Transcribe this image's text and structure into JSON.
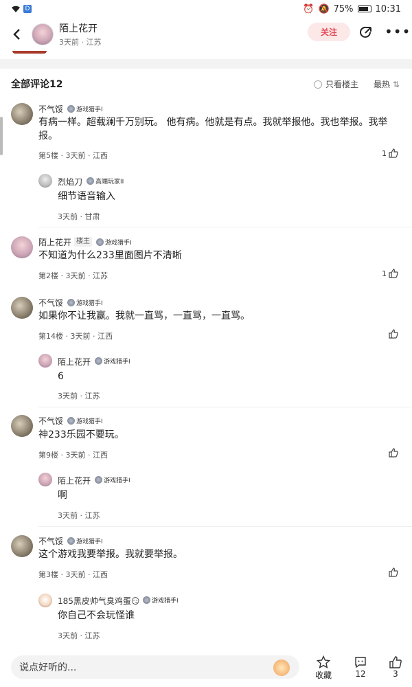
{
  "status": {
    "battery": "75%",
    "time": "10:31"
  },
  "header": {
    "name": "陌上花开",
    "meta": "3天前 · 江苏",
    "follow_label": "关注"
  },
  "section": {
    "title": "全部评论12",
    "only_op": "只看楼主",
    "sort": "最热"
  },
  "comments": [
    {
      "name": "不气馁",
      "level": "游戏猎手I",
      "text_l1": "有病一样。超载澜千万别玩。 他有病。他就是有点。我就举报他。我也举报。我举",
      "text_l2": "报。",
      "meta": "第5楼 · 3天前 · 江西",
      "likes": "1",
      "reply": {
        "name": "烈焰刀",
        "level": "高端玩家II",
        "text": "细节语音输入",
        "meta": "3天前 · 甘肃"
      }
    },
    {
      "name": "陌上花开",
      "op_tag": "楼主",
      "level": "游戏猎手I",
      "text": "不知道为什么233里面图片不清晰",
      "meta": "第2楼 · 3天前 · 江苏",
      "likes": "1"
    },
    {
      "name": "不气馁",
      "level": "游戏猎手I",
      "text": "如果你不让我赢。我就一直骂，一直骂，一直骂。",
      "meta": "第14楼 · 3天前 · 江西",
      "reply": {
        "name": "陌上花开",
        "level": "游戏猎手I",
        "text": "6",
        "meta": "3天前 · 江苏"
      }
    },
    {
      "name": "不气馁",
      "level": "游戏猎手I",
      "text": "神233乐园不要玩。",
      "meta": "第9楼 · 3天前 · 江西",
      "reply": {
        "name": "陌上花开",
        "level": "游戏猎手I",
        "text": "啊",
        "meta": "3天前 · 江苏"
      }
    },
    {
      "name": "不气馁",
      "level": "游戏猎手I",
      "text": "这个游戏我要举报。我就要举报。",
      "meta": "第3楼 · 3天前 · 江西",
      "reply": {
        "name": "185黑皮帅气臭鸡蛋😏",
        "level": "游戏猎手I",
        "text": "你自己不会玩怪谁",
        "meta": "3天前 · 江苏"
      }
    }
  ],
  "bottom": {
    "placeholder": "说点好听的...",
    "fav_label": "收藏",
    "comments_count": "12",
    "likes_count": "3"
  }
}
